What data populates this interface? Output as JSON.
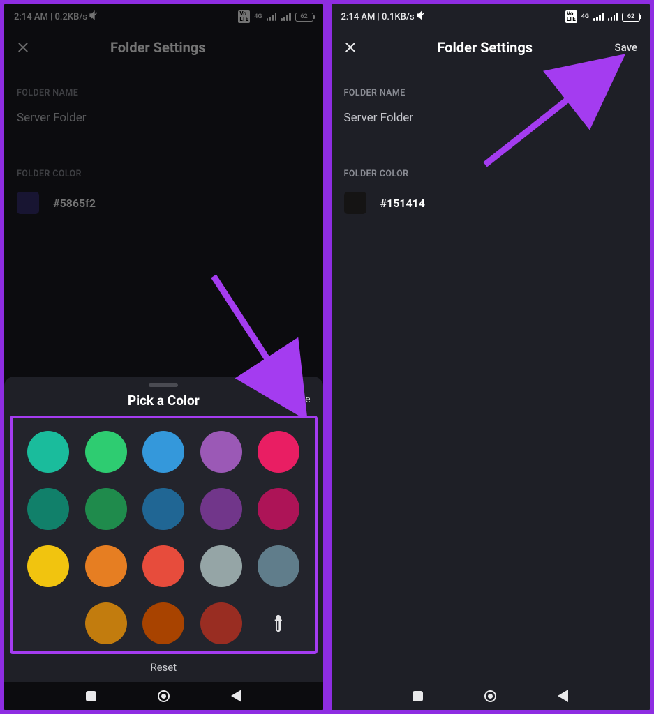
{
  "left": {
    "statusbar": {
      "time_net": "2:14 AM | 0.2KB/s",
      "net_gen": "4G",
      "battery": "62"
    },
    "header": {
      "title": "Folder Settings"
    },
    "sections": {
      "name_label": "FOLDER NAME",
      "name_value": "Server Folder",
      "color_label": "FOLDER COLOR",
      "color_hex": "#5865f2"
    },
    "sheet": {
      "title": "Pick a Color",
      "save": "Save",
      "reset": "Reset",
      "colors_row1": [
        "#1abc9c",
        "#2ecc71",
        "#3498db",
        "#9b59b6",
        "#e91e63"
      ],
      "colors_row2": [
        "#11806a",
        "#1f8b4c",
        "#206694",
        "#71368a",
        "#ad1457"
      ],
      "colors_row3": [
        "#f1c40f",
        "#e67e22",
        "#e74c3c",
        "#95a5a6",
        "#607d8b"
      ],
      "colors_row4": [
        "#c27c0e",
        "#a84300",
        "#992d22"
      ]
    }
  },
  "right": {
    "statusbar": {
      "time_net": "2:14 AM | 0.1KB/s",
      "net_gen": "4G",
      "battery": "62"
    },
    "header": {
      "title": "Folder Settings",
      "save": "Save"
    },
    "sections": {
      "name_label": "FOLDER NAME",
      "name_value": "Server Folder",
      "color_label": "FOLDER COLOR",
      "color_hex": "#151414"
    }
  },
  "annotation_color": "#a43cf0"
}
